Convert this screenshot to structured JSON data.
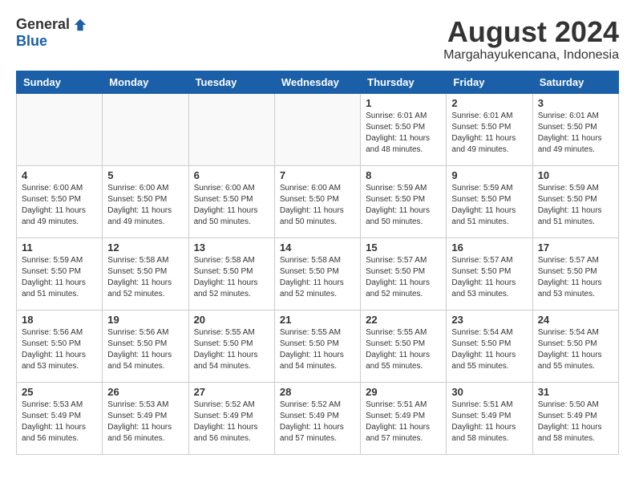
{
  "header": {
    "logo_general": "General",
    "logo_blue": "Blue",
    "month_year": "August 2024",
    "location": "Margahayukencana, Indonesia"
  },
  "days_of_week": [
    "Sunday",
    "Monday",
    "Tuesday",
    "Wednesday",
    "Thursday",
    "Friday",
    "Saturday"
  ],
  "weeks": [
    [
      {
        "day": "",
        "info": ""
      },
      {
        "day": "",
        "info": ""
      },
      {
        "day": "",
        "info": ""
      },
      {
        "day": "",
        "info": ""
      },
      {
        "day": "1",
        "info": "Sunrise: 6:01 AM\nSunset: 5:50 PM\nDaylight: 11 hours\nand 48 minutes."
      },
      {
        "day": "2",
        "info": "Sunrise: 6:01 AM\nSunset: 5:50 PM\nDaylight: 11 hours\nand 49 minutes."
      },
      {
        "day": "3",
        "info": "Sunrise: 6:01 AM\nSunset: 5:50 PM\nDaylight: 11 hours\nand 49 minutes."
      }
    ],
    [
      {
        "day": "4",
        "info": "Sunrise: 6:00 AM\nSunset: 5:50 PM\nDaylight: 11 hours\nand 49 minutes."
      },
      {
        "day": "5",
        "info": "Sunrise: 6:00 AM\nSunset: 5:50 PM\nDaylight: 11 hours\nand 49 minutes."
      },
      {
        "day": "6",
        "info": "Sunrise: 6:00 AM\nSunset: 5:50 PM\nDaylight: 11 hours\nand 50 minutes."
      },
      {
        "day": "7",
        "info": "Sunrise: 6:00 AM\nSunset: 5:50 PM\nDaylight: 11 hours\nand 50 minutes."
      },
      {
        "day": "8",
        "info": "Sunrise: 5:59 AM\nSunset: 5:50 PM\nDaylight: 11 hours\nand 50 minutes."
      },
      {
        "day": "9",
        "info": "Sunrise: 5:59 AM\nSunset: 5:50 PM\nDaylight: 11 hours\nand 51 minutes."
      },
      {
        "day": "10",
        "info": "Sunrise: 5:59 AM\nSunset: 5:50 PM\nDaylight: 11 hours\nand 51 minutes."
      }
    ],
    [
      {
        "day": "11",
        "info": "Sunrise: 5:59 AM\nSunset: 5:50 PM\nDaylight: 11 hours\nand 51 minutes."
      },
      {
        "day": "12",
        "info": "Sunrise: 5:58 AM\nSunset: 5:50 PM\nDaylight: 11 hours\nand 52 minutes."
      },
      {
        "day": "13",
        "info": "Sunrise: 5:58 AM\nSunset: 5:50 PM\nDaylight: 11 hours\nand 52 minutes."
      },
      {
        "day": "14",
        "info": "Sunrise: 5:58 AM\nSunset: 5:50 PM\nDaylight: 11 hours\nand 52 minutes."
      },
      {
        "day": "15",
        "info": "Sunrise: 5:57 AM\nSunset: 5:50 PM\nDaylight: 11 hours\nand 52 minutes."
      },
      {
        "day": "16",
        "info": "Sunrise: 5:57 AM\nSunset: 5:50 PM\nDaylight: 11 hours\nand 53 minutes."
      },
      {
        "day": "17",
        "info": "Sunrise: 5:57 AM\nSunset: 5:50 PM\nDaylight: 11 hours\nand 53 minutes."
      }
    ],
    [
      {
        "day": "18",
        "info": "Sunrise: 5:56 AM\nSunset: 5:50 PM\nDaylight: 11 hours\nand 53 minutes."
      },
      {
        "day": "19",
        "info": "Sunrise: 5:56 AM\nSunset: 5:50 PM\nDaylight: 11 hours\nand 54 minutes."
      },
      {
        "day": "20",
        "info": "Sunrise: 5:55 AM\nSunset: 5:50 PM\nDaylight: 11 hours\nand 54 minutes."
      },
      {
        "day": "21",
        "info": "Sunrise: 5:55 AM\nSunset: 5:50 PM\nDaylight: 11 hours\nand 54 minutes."
      },
      {
        "day": "22",
        "info": "Sunrise: 5:55 AM\nSunset: 5:50 PM\nDaylight: 11 hours\nand 55 minutes."
      },
      {
        "day": "23",
        "info": "Sunrise: 5:54 AM\nSunset: 5:50 PM\nDaylight: 11 hours\nand 55 minutes."
      },
      {
        "day": "24",
        "info": "Sunrise: 5:54 AM\nSunset: 5:50 PM\nDaylight: 11 hours\nand 55 minutes."
      }
    ],
    [
      {
        "day": "25",
        "info": "Sunrise: 5:53 AM\nSunset: 5:49 PM\nDaylight: 11 hours\nand 56 minutes."
      },
      {
        "day": "26",
        "info": "Sunrise: 5:53 AM\nSunset: 5:49 PM\nDaylight: 11 hours\nand 56 minutes."
      },
      {
        "day": "27",
        "info": "Sunrise: 5:52 AM\nSunset: 5:49 PM\nDaylight: 11 hours\nand 56 minutes."
      },
      {
        "day": "28",
        "info": "Sunrise: 5:52 AM\nSunset: 5:49 PM\nDaylight: 11 hours\nand 57 minutes."
      },
      {
        "day": "29",
        "info": "Sunrise: 5:51 AM\nSunset: 5:49 PM\nDaylight: 11 hours\nand 57 minutes."
      },
      {
        "day": "30",
        "info": "Sunrise: 5:51 AM\nSunset: 5:49 PM\nDaylight: 11 hours\nand 58 minutes."
      },
      {
        "day": "31",
        "info": "Sunrise: 5:50 AM\nSunset: 5:49 PM\nDaylight: 11 hours\nand 58 minutes."
      }
    ]
  ]
}
